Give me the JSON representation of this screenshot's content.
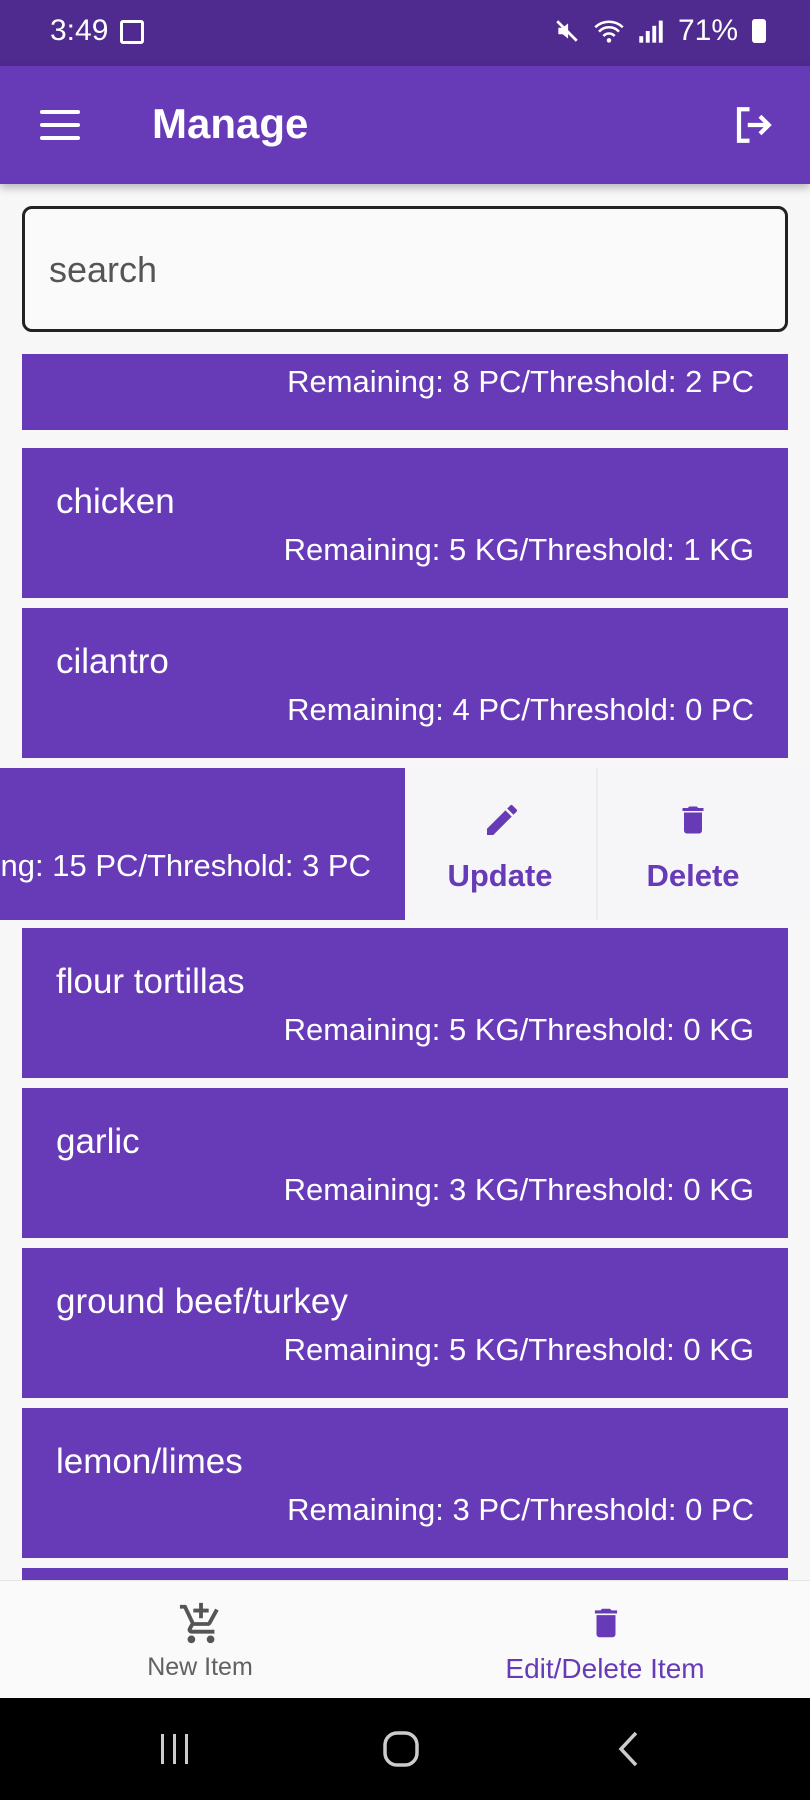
{
  "status": {
    "time": "3:49",
    "battery": "71%"
  },
  "appbar": {
    "title": "Manage"
  },
  "search": {
    "placeholder": "search"
  },
  "items": [
    {
      "name": "",
      "detail": "Remaining: 8 PC/Threshold: 2 PC"
    },
    {
      "name": "chicken",
      "detail": "Remaining: 5 KG/Threshold: 1 KG"
    },
    {
      "name": "cilantro",
      "detail": "Remaining: 4 PC/Threshold: 0 PC"
    },
    {
      "name": "",
      "detail": "ng: 15 PC/Threshold: 3 PC"
    },
    {
      "name": "flour tortillas",
      "detail": "Remaining: 5 KG/Threshold: 0 KG"
    },
    {
      "name": "garlic",
      "detail": "Remaining: 3 KG/Threshold: 0 KG"
    },
    {
      "name": "ground beef/turkey",
      "detail": "Remaining: 5 KG/Threshold: 0 KG"
    },
    {
      "name": "lemon/limes",
      "detail": "Remaining: 3 PC/Threshold: 0 PC"
    }
  ],
  "actions": {
    "update": "Update",
    "delete": "Delete"
  },
  "bottom_nav": {
    "new_item": "New Item",
    "edit_delete": "Edit/Delete Item"
  },
  "colors": {
    "primary": "#673ab7",
    "status_bar": "#4f2a8f"
  }
}
